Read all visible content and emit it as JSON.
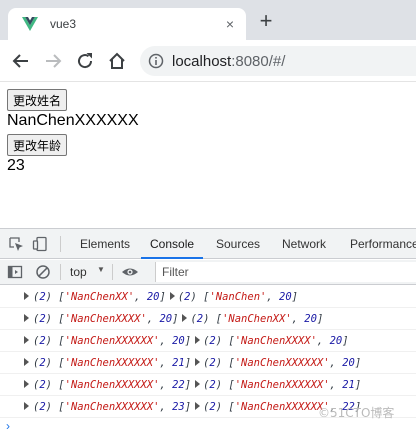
{
  "tab": {
    "title": "vue3",
    "close": "×",
    "new_tab": "+"
  },
  "address": {
    "host": "localhost",
    "rest": ":8080/#/"
  },
  "page": {
    "rename_button": "更改姓名",
    "name_value": "NanChenXXXXXX",
    "age_button": "更改年龄",
    "age_value": "23"
  },
  "devtools": {
    "tabs": [
      "Elements",
      "Console",
      "Sources",
      "Network",
      "Performance"
    ],
    "active_tab": "Console",
    "context": "top",
    "filter_placeholder": "Filter",
    "logs": [
      {
        "new": "(2) ['NanChenXX', 20]",
        "old": "(2) ['NanChen', 20]"
      },
      {
        "new": "(2) ['NanChenXXXX', 20]",
        "old": "(2) ['NanChenXX', 20]"
      },
      {
        "new": "(2) ['NanChenXXXXXX', 20]",
        "old": "(2) ['NanChenXXXX', 20]"
      },
      {
        "new": "(2) ['NanChenXXXXXX', 21]",
        "old": "(2) ['NanChenXXXXXX', 20]"
      },
      {
        "new": "(2) ['NanChenXXXXXX', 22]",
        "old": "(2) ['NanChenXXXXXX', 21]"
      },
      {
        "new": "(2) ['NanChenXXXXXX', 23]",
        "old": "(2) ['NanChenXXXXXX', 22]"
      }
    ],
    "prompt": "›"
  },
  "watermark": "©51CTO博客",
  "colors": {
    "accent": "#1a73e8",
    "vue_green": "#41b883",
    "vue_dark": "#35495e"
  }
}
